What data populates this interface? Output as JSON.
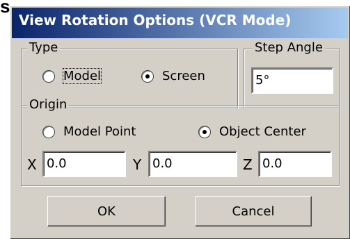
{
  "background_text": "s",
  "window": {
    "title": "View Rotation Options (VCR Mode)"
  },
  "type_group": {
    "label": "Type",
    "options": [
      {
        "label": "Model",
        "checked": false
      },
      {
        "label": "Screen",
        "checked": true
      }
    ]
  },
  "step_angle": {
    "label": "Step Angle",
    "value": "5°"
  },
  "origin_group": {
    "label": "Origin",
    "options": [
      {
        "label": "Model Point",
        "checked": false
      },
      {
        "label": "Object Center",
        "checked": true
      }
    ],
    "x_label": "X",
    "x_value": "0.0",
    "y_label": "Y",
    "y_value": "0.0",
    "z_label": "Z",
    "z_value": "0.0"
  },
  "buttons": {
    "ok_label": "OK",
    "cancel_label": "Cancel"
  },
  "colors": {
    "dialog_face": "#d4d0c8",
    "title_start": "#0a246a",
    "title_end": "#a6caf0"
  }
}
